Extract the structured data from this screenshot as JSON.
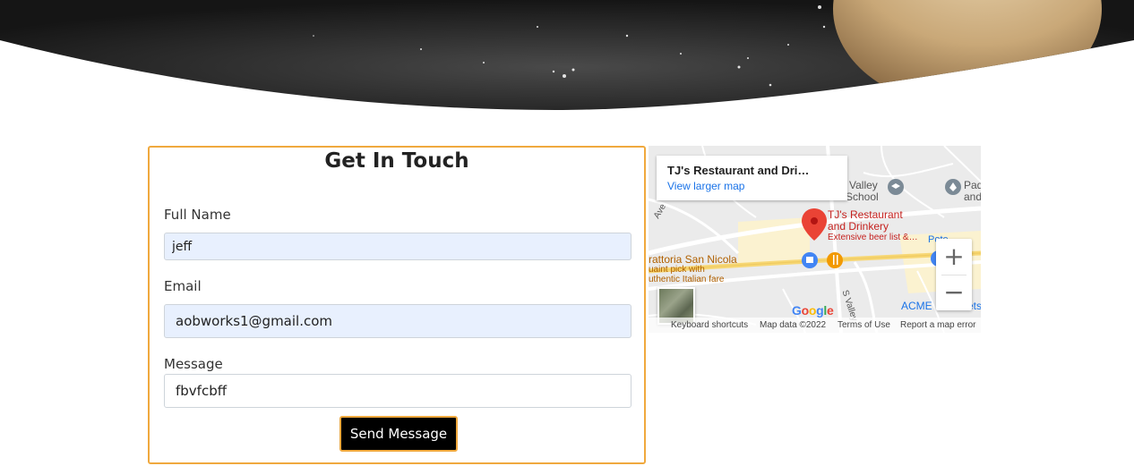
{
  "contact": {
    "title": "Get In Touch",
    "full_name_label": "Full Name",
    "full_name_value": "jeff",
    "email_label": "Email",
    "email_value": "aobworks1@gmail.com",
    "message_label": "Message",
    "message_value": "fbvfcbff",
    "send_label": "Send Message"
  },
  "map": {
    "place_name": "TJ's Restaurant and Dri…",
    "view_larger": "View larger map",
    "marker_title_1": "TJ's Restaurant",
    "marker_title_2": "and Drinkery",
    "marker_sub": "Extensive beer list &…",
    "poi_trattoria": "rattoria San Nicola",
    "poi_trattoria_sub_1": "uaint pick with",
    "poi_trattoria_sub_2": "uthentic Italian fare",
    "poi_school_1": "Valley",
    "poi_school_2": "School",
    "poi_pad_1": "Pad",
    "poi_pad_2": "and",
    "poi_acme": "ACME",
    "poi_acme_tail": "ets",
    "poi_pote": "Pote",
    "street_s_valley": "S Valley",
    "street_ave": "Ave",
    "zoom_in": "+",
    "zoom_out": "−",
    "google": "Google",
    "footer": {
      "shortcuts": "Keyboard shortcuts",
      "data": "Map data ©2022",
      "terms": "Terms of Use",
      "report": "Report a map error"
    }
  },
  "colors": {
    "accent": "#f0a93e",
    "input_fill": "#e8f0fe",
    "button_bg": "#000000",
    "link": "#1a73e8",
    "marker": "#ea4335"
  }
}
